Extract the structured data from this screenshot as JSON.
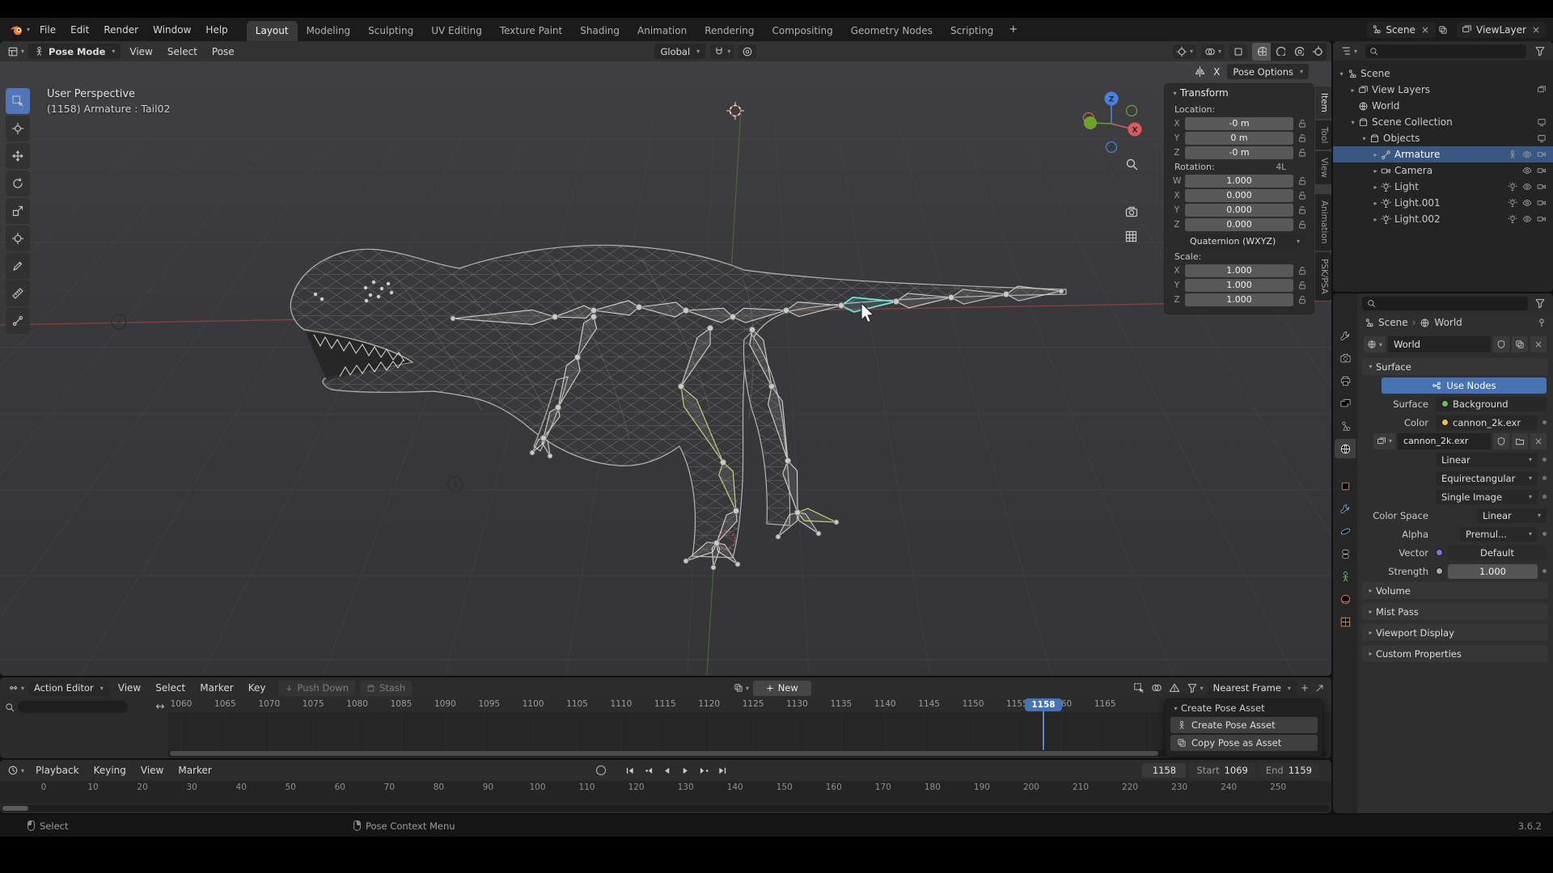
{
  "menubar": {
    "menus": [
      "File",
      "Edit",
      "Render",
      "Window",
      "Help"
    ],
    "workspaces": [
      {
        "label": "Layout",
        "active": true
      },
      {
        "label": "Modeling"
      },
      {
        "label": "Sculpting"
      },
      {
        "label": "UV Editing"
      },
      {
        "label": "Texture Paint"
      },
      {
        "label": "Shading"
      },
      {
        "label": "Animation"
      },
      {
        "label": "Rendering"
      },
      {
        "label": "Compositing"
      },
      {
        "label": "Geometry Nodes"
      },
      {
        "label": "Scripting"
      }
    ],
    "scene_name": "Scene",
    "view_layer_name": "ViewLayer"
  },
  "viewport": {
    "mode": "Pose Mode",
    "menus": [
      "View",
      "Select",
      "Pose"
    ],
    "orientation": "Global",
    "mirror_axis": "X",
    "pose_options": "Pose Options",
    "overlay_line1": "User Perspective",
    "overlay_line2": "(1158) Armature : Tail02",
    "gizmo": {
      "x": "X",
      "z": "Z"
    }
  },
  "npanel": {
    "title": "Transform",
    "tabs": [
      {
        "label": "Item",
        "active": true
      },
      {
        "label": "Tool"
      },
      {
        "label": "View"
      },
      {
        "label": "Animation"
      },
      {
        "label": "PSK/PSA"
      }
    ],
    "location_label": "Location:",
    "location": [
      {
        "axis": "X",
        "value": "-0 m"
      },
      {
        "axis": "Y",
        "value": "0 m"
      },
      {
        "axis": "Z",
        "value": "-0 m"
      }
    ],
    "rotation_label": "Rotation:",
    "rotation_badge": "4L",
    "rotation": [
      {
        "axis": "W",
        "value": "1.000"
      },
      {
        "axis": "X",
        "value": "0.000"
      },
      {
        "axis": "Y",
        "value": "0.000"
      },
      {
        "axis": "Z",
        "value": "0.000"
      }
    ],
    "rotation_mode": "Quaternion (WXYZ)",
    "scale_label": "Scale:",
    "scale": [
      {
        "axis": "X",
        "value": "1.000"
      },
      {
        "axis": "Y",
        "value": "1.000"
      },
      {
        "axis": "Z",
        "value": "1.000"
      }
    ]
  },
  "outliner": {
    "rows": [
      {
        "label": "Scene"
      },
      {
        "label": "View Layers"
      },
      {
        "label": "World"
      },
      {
        "label": "Scene Collection"
      },
      {
        "label": "Objects"
      },
      {
        "label": "Armature",
        "selected": true
      },
      {
        "label": "Camera"
      },
      {
        "label": "Light"
      },
      {
        "label": "Light.001"
      },
      {
        "label": "Light.002"
      }
    ]
  },
  "properties": {
    "breadcrumb": [
      "Scene",
      "World"
    ],
    "world_name": "World",
    "surface_panel": {
      "title": "Surface",
      "use_nodes": "Use Nodes",
      "surface_label": "Surface",
      "surface_value": "Background",
      "color_label": "Color",
      "color_value": "cannon_2k.exr",
      "image_name": "cannon_2k.exr",
      "interpolation": "Linear",
      "projection": "Equirectangular",
      "source": "Single Image",
      "color_space_label": "Color Space",
      "color_space": "Linear",
      "alpha_label": "Alpha",
      "alpha_value": "Premul...",
      "vector_label": "Vector",
      "vector_value": "Default",
      "strength_label": "Strength",
      "strength_value": "1.000"
    },
    "collapsed_panels": [
      "Volume",
      "Mist Pass",
      "Viewport Display",
      "Custom Properties"
    ]
  },
  "dopesheet": {
    "editor_type": "Action Editor",
    "menus": [
      "View",
      "Select",
      "Marker",
      "Key"
    ],
    "push_down": "Push Down",
    "stash": "Stash",
    "new_button": "New",
    "snap_mode": "Nearest Frame",
    "current_frame": "1158",
    "ruler": [
      "1060",
      "1065",
      "1070",
      "1075",
      "1080",
      "1085",
      "1090",
      "1095",
      "1100",
      "1105",
      "1110",
      "1115",
      "1120",
      "1125",
      "1130",
      "1135",
      "1140",
      "1145",
      "1150",
      "1155",
      "1160",
      "1165"
    ],
    "pose_asset": {
      "title": "Create Pose Asset",
      "create": "Create Pose Asset",
      "copy": "Copy Pose as Asset"
    }
  },
  "timeline": {
    "menus": [
      "Playback",
      "Keying",
      "View",
      "Marker"
    ],
    "current_frame": "1158",
    "start_label": "Start",
    "start_value": "1069",
    "end_label": "End",
    "end_value": "1159",
    "ruler": [
      "0",
      "10",
      "20",
      "30",
      "40",
      "50",
      "60",
      "70",
      "80",
      "90",
      "100",
      "110",
      "120",
      "130",
      "140",
      "150",
      "160",
      "170",
      "180",
      "190",
      "200",
      "210",
      "220",
      "230",
      "240",
      "250"
    ]
  },
  "statusbar": {
    "select": "Select",
    "context_menu": "Pose Context Menu",
    "version": "3.6.2"
  }
}
